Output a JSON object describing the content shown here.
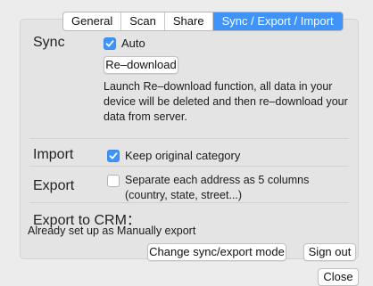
{
  "tabs": [
    {
      "label": "General",
      "active": false
    },
    {
      "label": "Scan",
      "active": false
    },
    {
      "label": "Share",
      "active": false
    },
    {
      "label": "Sync / Export / Import",
      "active": true
    }
  ],
  "sync": {
    "label": "Sync",
    "auto_label": "Auto",
    "auto_checked": true,
    "redownload_button": "Re–download",
    "description": "Launch Re–download function, all data in your device will be deleted and then re–download your data from server."
  },
  "import": {
    "label": "Import",
    "keep_category_label": "Keep original category",
    "keep_category_checked": true
  },
  "export": {
    "label": "Export",
    "separate_label": "Separate each address as 5 columns (country, state, street...)",
    "separate_checked": false
  },
  "crm": {
    "title": "Export to CRM：",
    "status": "Already set up as Manually export",
    "change_mode_button": "Change sync/export mode",
    "sign_out_button": "Sign out"
  },
  "footer": {
    "close_button": "Close"
  },
  "colors": {
    "accent": "#3f93f9",
    "window_bg": "#ececec",
    "panel_bg": "#e4e4e4"
  }
}
